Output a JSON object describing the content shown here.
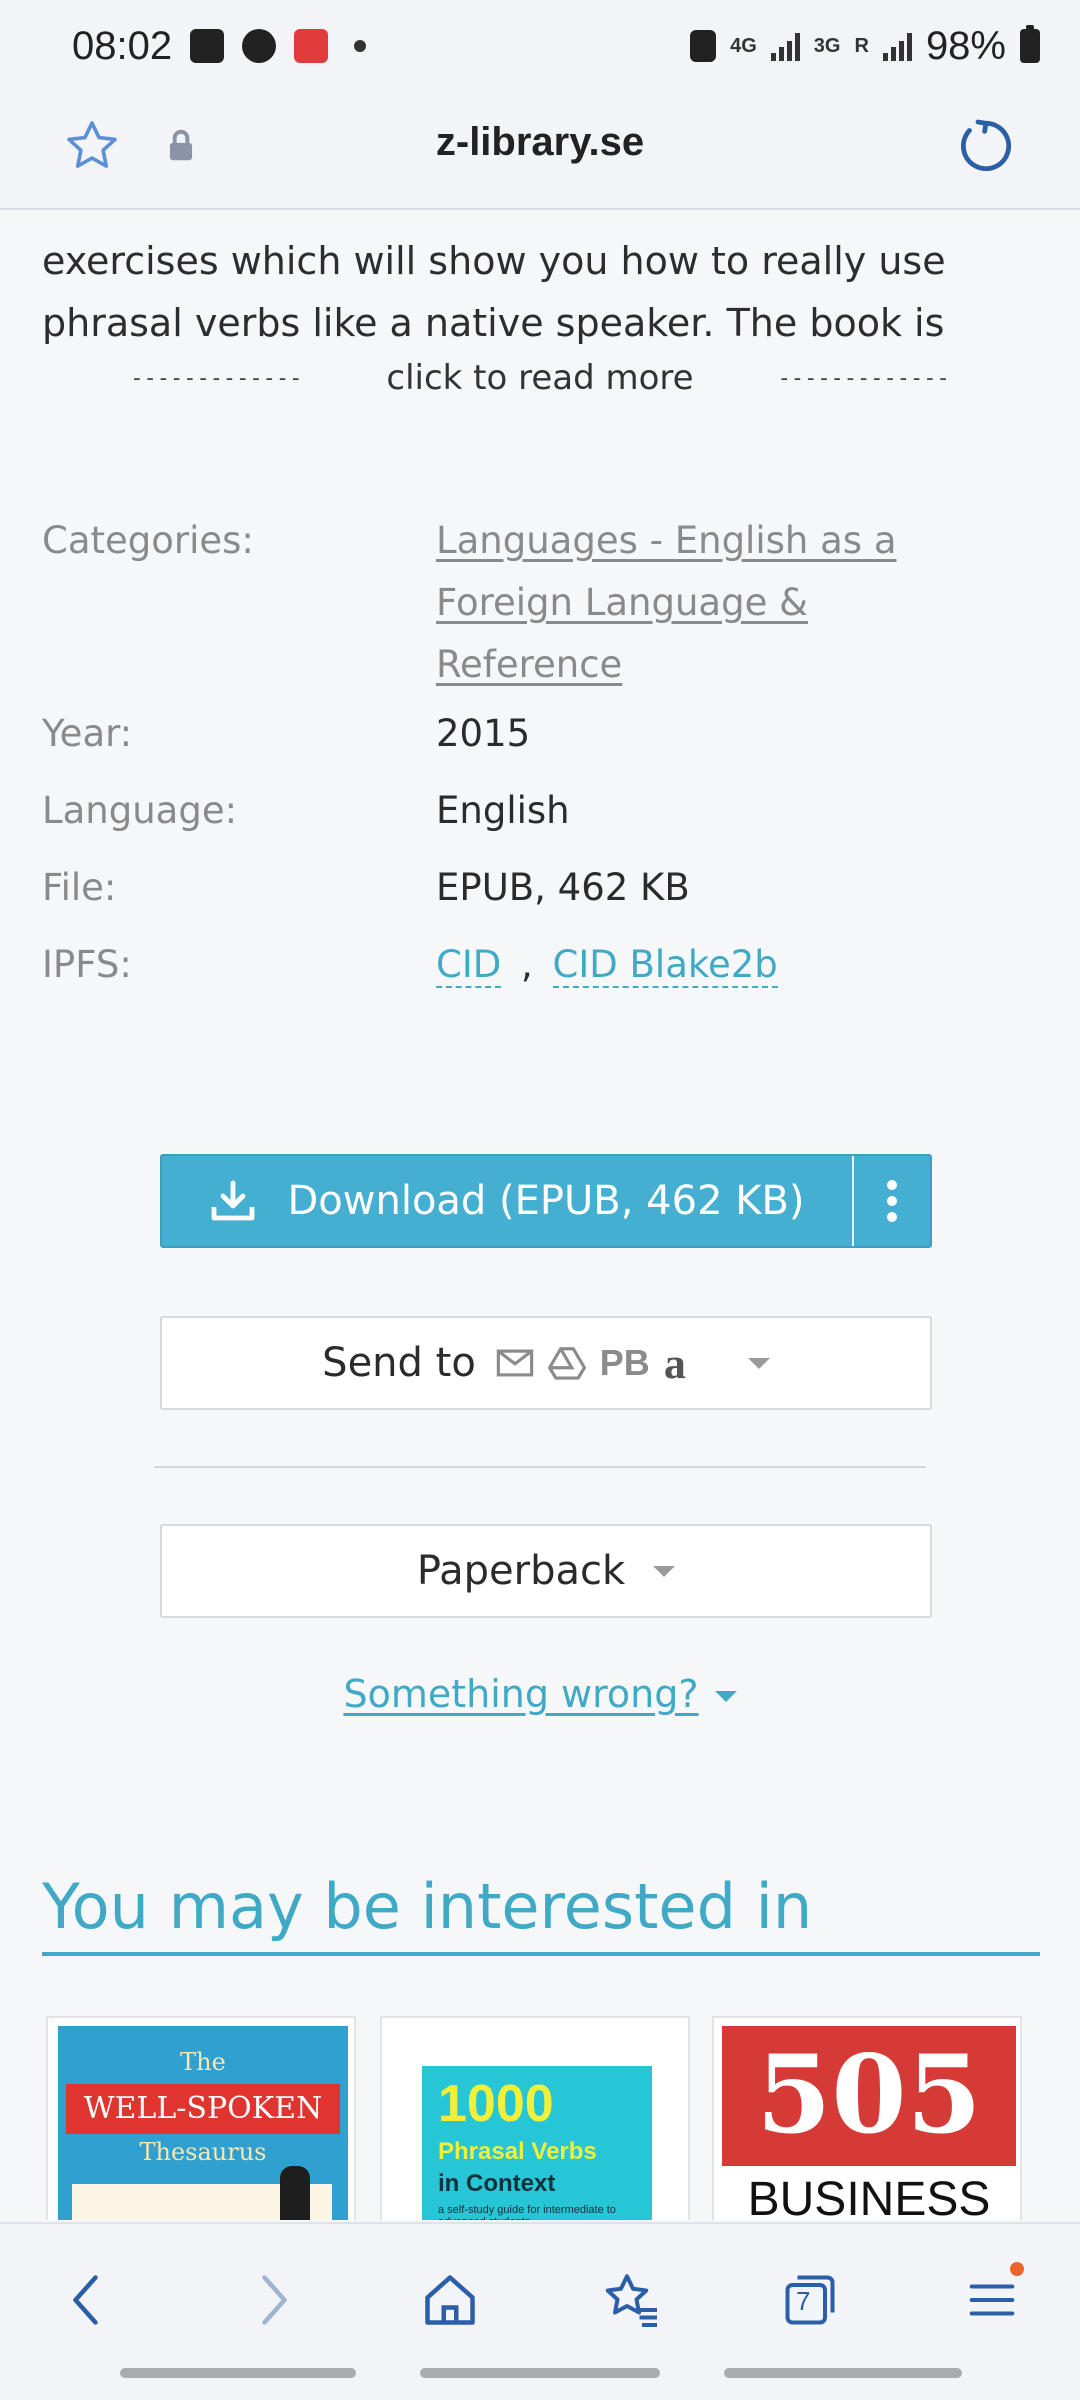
{
  "status_bar": {
    "time": "08:02",
    "net1": "4G",
    "net2": "3G",
    "roaming": "R",
    "battery": "98%",
    "notif_badge": "小红书"
  },
  "browser": {
    "url": "z-library.se",
    "icons": [
      "star-icon",
      "lock-icon",
      "reload-icon"
    ]
  },
  "description": {
    "cut_line": "... ... ... ... ...",
    "line1": "exercises which will show you how to really use",
    "line2": "phrasal verbs like a native speaker. The book is",
    "read_more": "click to read more",
    "dashes": "-------------"
  },
  "properties": {
    "categories_label": "Categories:",
    "categories_line1": "Languages - English as a",
    "categories_line2": "Foreign Language &",
    "categories_line3": "Reference",
    "year_label": "Year:",
    "year_value": "2015",
    "language_label": "Language:",
    "language_value": "English",
    "file_label": "File:",
    "file_value": "EPUB, 462 KB",
    "ipfs_label": "IPFS:",
    "ipfs_cid": "CID",
    "ipfs_sep": ",",
    "ipfs_blake": "CID Blake2b"
  },
  "actions": {
    "download_label": "Download (EPUB, 462 KB)",
    "send_to_label": "Send to",
    "send_pb": "PB",
    "send_amazon": "a",
    "paperback_label": "Paperback",
    "something_wrong": "Something wrong?"
  },
  "recommendations": {
    "title": "You may be interested in",
    "books": [
      {
        "top": "The",
        "main": "WELL-SPOKEN",
        "sub": "Thesaurus"
      },
      {
        "num": "1000",
        "l1": "Phrasal Verbs",
        "l2": "in Context",
        "l3": "a self-study guide for intermediate to advanced students"
      },
      {
        "num": "505",
        "l1": "BUSINESS"
      }
    ]
  },
  "bottom_nav": {
    "tab_count": "7"
  },
  "colors": {
    "accent": "#3fa9c6",
    "download_bg": "#45afd1"
  }
}
